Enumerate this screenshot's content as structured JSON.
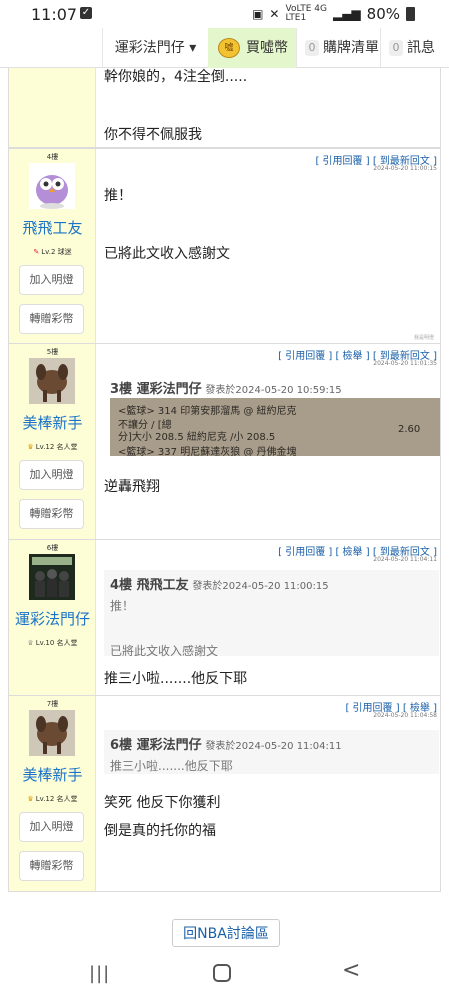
{
  "status": {
    "time": "11:07",
    "network": "VoLTE 4G",
    "sub": "LTE1",
    "battery": "80%"
  },
  "nav": {
    "forum": "運彩法門仔 ▾",
    "coin_icon": "coin-icon",
    "buy": "買噓幣",
    "cart_count": "0",
    "cart": "購牌清單",
    "msg_count": "0",
    "msg": "訊息"
  },
  "posts": {
    "p3": {
      "line1": "幹你娘的，4注全倒.....",
      "line2": "你不得不佩服我"
    },
    "p4": {
      "floor": "4樓",
      "user": "飛飛工友",
      "level": "Lv.2 球迷",
      "quote_btn": "[ 引用回覆 ]",
      "latest_btn": "[ 到最新回文 ]",
      "stamp": "2024-05-20 11:00:15",
      "line1": "推！",
      "line2": "已將此文收入感謝文",
      "follow": "加入明燈",
      "gift": "轉贈彩幣",
      "ghost": "我是明燈"
    },
    "p5": {
      "floor": "5樓",
      "user": "美棒新手",
      "level": "Lv.12 名人堂",
      "quote_btn": "[ 引用回覆 ]",
      "report_btn": "[ 檢舉 ]",
      "latest_btn": "[ 到最新回文 ]",
      "stamp": "2024-05-20 11:01:35",
      "q_head": "3樓 運彩法門仔",
      "q_meta": "發表於2024-05-20 10:59:15",
      "ticket": {
        "r1": "<籃球> 314   印第安那溜馬 @ 紐約尼克",
        "r2": "不讓分 / [總",
        "r3": "分]大小 208.5  紐約尼克 /小 208.5",
        "r3b": "2.60",
        "r4": "<籃球> 337   明尼蘇達灰狼 @ 丹佛金塊"
      },
      "line1": "逆轟飛翔",
      "follow": "加入明燈",
      "gift": "轉贈彩幣"
    },
    "p6": {
      "floor": "6樓",
      "user": "運彩法門仔",
      "level": "Lv.10 名人堂",
      "quote_btn": "[ 引用回覆 ]",
      "report_btn": "[ 檢舉 ]",
      "latest_btn": "[ 到最新回文 ]",
      "stamp": "2024-05-20 11:04:11",
      "q_head": "4樓 飛飛工友",
      "q_meta": "發表於2024-05-20 11:00:15",
      "q_line1": "推！",
      "q_line2": "已將此文收入感謝文",
      "line1": "推三小啦.......他反下耶"
    },
    "p7": {
      "floor": "7樓",
      "user": "美棒新手",
      "level": "Lv.12 名人堂",
      "quote_btn": "[ 引用回覆 ]",
      "report_btn": "[ 檢舉 ]",
      "stamp": "2024-05-20 11:04:58",
      "q_head": "6樓 運彩法門仔",
      "q_meta": "發表於2024-05-20 11:04:11",
      "q_line1": "推三小啦.......他反下耶",
      "line1": "笑死 他反下你獲利",
      "line2": "倒是真的托你的福",
      "follow": "加入明燈",
      "gift": "轉贈彩幣"
    }
  },
  "back": "回NBA討論區",
  "navbar": {
    "recent": "|||",
    "home": "home-icon",
    "back": "<"
  }
}
